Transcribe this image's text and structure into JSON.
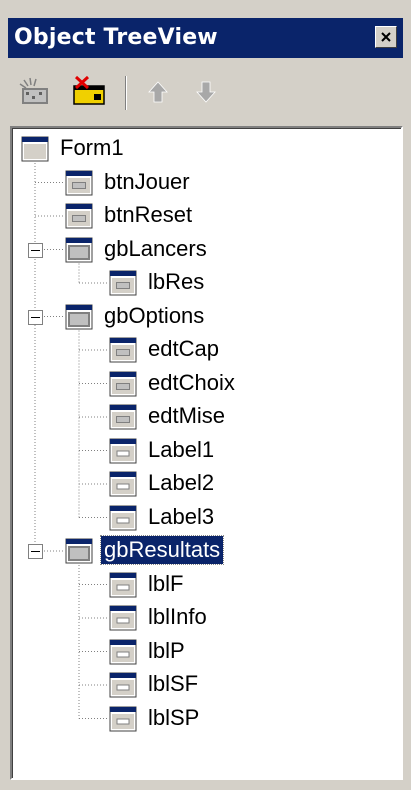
{
  "window": {
    "title": "Object TreeView"
  },
  "toolbar": {
    "buttons": [
      {
        "icon": "new-component-icon"
      },
      {
        "icon": "delete-component-icon"
      },
      {
        "icon": "arrow-up-icon"
      },
      {
        "icon": "arrow-down-icon"
      }
    ]
  },
  "tree": {
    "nodes": [
      {
        "label": "Form1",
        "level": 0,
        "icon": "form-icon",
        "expander": "none"
      },
      {
        "label": "btnJouer",
        "level": 1,
        "icon": "button-icon",
        "expander": "none"
      },
      {
        "label": "btnReset",
        "level": 1,
        "icon": "button-icon",
        "expander": "none"
      },
      {
        "label": "gbLancers",
        "level": 1,
        "icon": "groupbox-icon",
        "expander": "minus"
      },
      {
        "label": "lbRes",
        "level": 2,
        "icon": "button-icon",
        "expander": "none"
      },
      {
        "label": "gbOptions",
        "level": 1,
        "icon": "groupbox-icon",
        "expander": "minus"
      },
      {
        "label": "edtCap",
        "level": 2,
        "icon": "button-icon",
        "expander": "none"
      },
      {
        "label": "edtChoix",
        "level": 2,
        "icon": "button-icon",
        "expander": "none"
      },
      {
        "label": "edtMise",
        "level": 2,
        "icon": "button-icon",
        "expander": "none"
      },
      {
        "label": "Label1",
        "level": 2,
        "icon": "label-icon",
        "expander": "none"
      },
      {
        "label": "Label2",
        "level": 2,
        "icon": "label-icon",
        "expander": "none"
      },
      {
        "label": "Label3",
        "level": 2,
        "icon": "label-icon",
        "expander": "none"
      },
      {
        "label": "gbResultats",
        "level": 1,
        "icon": "groupbox-icon",
        "expander": "minus",
        "selected": true
      },
      {
        "label": "lblF",
        "level": 2,
        "icon": "label-icon",
        "expander": "none"
      },
      {
        "label": "lblInfo",
        "level": 2,
        "icon": "label-icon",
        "expander": "none"
      },
      {
        "label": "lblP",
        "level": 2,
        "icon": "label-icon",
        "expander": "none"
      },
      {
        "label": "lblSF",
        "level": 2,
        "icon": "label-icon",
        "expander": "none"
      },
      {
        "label": "lblSP",
        "level": 2,
        "icon": "label-icon",
        "expander": "none"
      }
    ]
  },
  "colors": {
    "title_bar": "#0a246a",
    "selection": "#0a246a",
    "window_face": "#d4d0c8"
  }
}
